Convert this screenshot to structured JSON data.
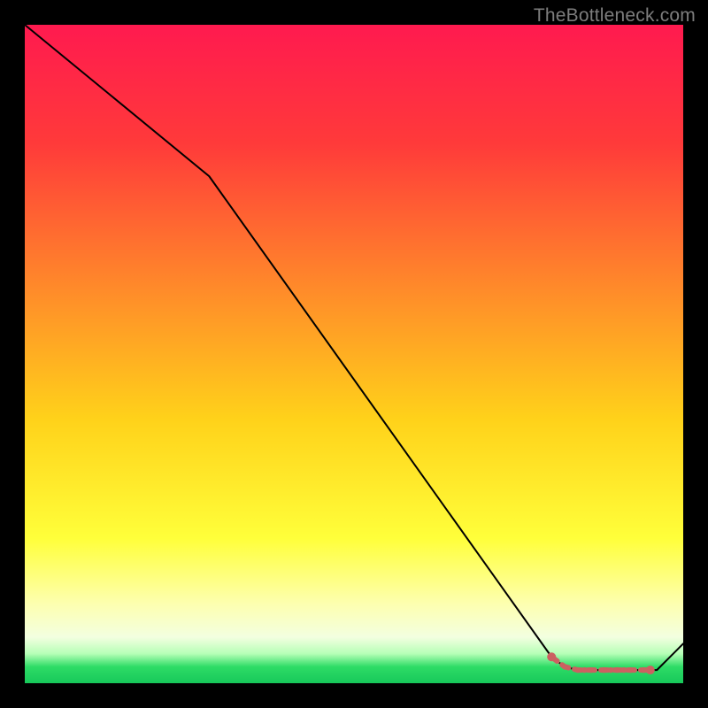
{
  "watermark": "TheBottleneck.com",
  "colors": {
    "page_bg": "#000000",
    "grad_top": "#ff1a4f",
    "grad_upper_mid": "#ff6a2a",
    "grad_mid": "#ffd21a",
    "grad_lower": "#ffff66",
    "grad_pale": "#fbffd0",
    "grad_green": "#2edc66",
    "line": "#000000",
    "marker": "#cb6161"
  },
  "chart_data": {
    "type": "line",
    "title": "",
    "xlabel": "",
    "ylabel": "",
    "xlim": [
      0,
      100
    ],
    "ylim": [
      0,
      100
    ],
    "series": [
      {
        "name": "bottleneck-curve",
        "x": [
          0,
          28,
          80,
          82,
          84,
          86,
          88,
          90,
          92,
          94,
          96,
          100
        ],
        "y": [
          100,
          77,
          4,
          2.5,
          2,
          2,
          2,
          2,
          2,
          2,
          2,
          6
        ]
      }
    ],
    "markers": {
      "name": "highlight-segment",
      "x": [
        80,
        82,
        84,
        85,
        86,
        88,
        89,
        90,
        91,
        92,
        94,
        95
      ],
      "y": [
        4,
        2.5,
        2,
        2,
        2,
        2,
        2,
        2,
        2,
        2,
        2,
        2
      ]
    }
  }
}
